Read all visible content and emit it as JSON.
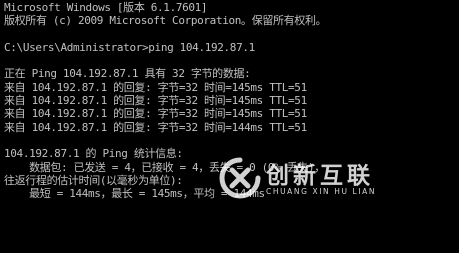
{
  "console": {
    "lines": [
      "Microsoft Windows [版本 6.1.7601]",
      "版权所有 (c) 2009 Microsoft Corporation。保留所有权利。",
      "",
      "C:\\Users\\Administrator>ping 104.192.87.1",
      "",
      "正在 Ping 104.192.87.1 具有 32 字节的数据:",
      "来自 104.192.87.1 的回复: 字节=32 时间=145ms TTL=51",
      "来自 104.192.87.1 的回复: 字节=32 时间=145ms TTL=51",
      "来自 104.192.87.1 的回复: 字节=32 时间=145ms TTL=51",
      "来自 104.192.87.1 的回复: 字节=32 时间=144ms TTL=51",
      "",
      "104.192.87.1 的 Ping 统计信息:",
      "    数据包: 已发送 = 4，已接收 = 4，丢失 = 0 (0% 丢失)，",
      "往返行程的估计时间(以毫秒为单位):",
      "    最短 = 144ms，最长 = 145ms，平均 = 144ms"
    ]
  },
  "watermark": {
    "title": "创新互联",
    "subtitle": "CHUANG XIN HU LIAN",
    "icon": "chuangxin-logo-icon"
  }
}
